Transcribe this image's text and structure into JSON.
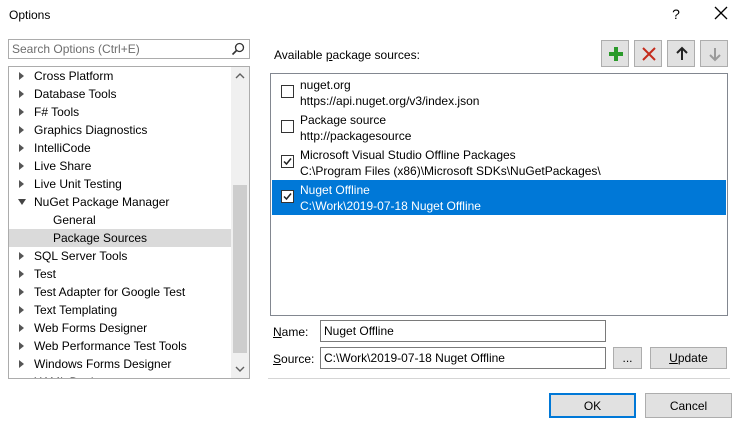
{
  "window": {
    "title": "Options",
    "help_glyph": "?"
  },
  "search": {
    "placeholder": "Search Options (Ctrl+E)"
  },
  "tree": {
    "items": [
      {
        "label": "Cross Platform",
        "level": 0,
        "expanded": false,
        "selected": false
      },
      {
        "label": "Database Tools",
        "level": 0,
        "expanded": false,
        "selected": false
      },
      {
        "label": "F# Tools",
        "level": 0,
        "expanded": false,
        "selected": false
      },
      {
        "label": "Graphics Diagnostics",
        "level": 0,
        "expanded": false,
        "selected": false
      },
      {
        "label": "IntelliCode",
        "level": 0,
        "expanded": false,
        "selected": false
      },
      {
        "label": "Live Share",
        "level": 0,
        "expanded": false,
        "selected": false
      },
      {
        "label": "Live Unit Testing",
        "level": 0,
        "expanded": false,
        "selected": false
      },
      {
        "label": "NuGet Package Manager",
        "level": 0,
        "expanded": true,
        "selected": false
      },
      {
        "label": "General",
        "level": 1,
        "expanded": false,
        "selected": false
      },
      {
        "label": "Package Sources",
        "level": 1,
        "expanded": false,
        "selected": true
      },
      {
        "label": "SQL Server Tools",
        "level": 0,
        "expanded": false,
        "selected": false
      },
      {
        "label": "Test",
        "level": 0,
        "expanded": false,
        "selected": false
      },
      {
        "label": "Test Adapter for Google Test",
        "level": 0,
        "expanded": false,
        "selected": false
      },
      {
        "label": "Text Templating",
        "level": 0,
        "expanded": false,
        "selected": false
      },
      {
        "label": "Web Forms Designer",
        "level": 0,
        "expanded": false,
        "selected": false
      },
      {
        "label": "Web Performance Test Tools",
        "level": 0,
        "expanded": false,
        "selected": false
      },
      {
        "label": "Windows Forms Designer",
        "level": 0,
        "expanded": false,
        "selected": false
      },
      {
        "label": "XAML Designer",
        "level": 0,
        "expanded": false,
        "selected": false
      }
    ]
  },
  "sources_panel": {
    "label_pre": "Available ",
    "label_accel": "p",
    "label_post": "ackage sources:",
    "toolbar": {
      "add_icon": "plus-icon",
      "add_color": "#2a9a2a",
      "remove_icon": "x-icon",
      "remove_color": "#c42b1c",
      "up_icon": "arrow-up-icon",
      "down_icon": "arrow-down-icon"
    },
    "sources": [
      {
        "name": "nuget.org",
        "url": "https://api.nuget.org/v3/index.json",
        "checked": false,
        "selected": false
      },
      {
        "name": "Package source",
        "url": "http://packagesource",
        "checked": false,
        "selected": false
      },
      {
        "name": "Microsoft Visual Studio Offline Packages",
        "url": "C:\\Program Files (x86)\\Microsoft SDKs\\NuGetPackages\\",
        "checked": true,
        "selected": false
      },
      {
        "name": "Nuget Offline",
        "url": "C:\\Work\\2019-07-18 Nuget Offline",
        "checked": true,
        "selected": true
      }
    ]
  },
  "form": {
    "name_label_accel": "N",
    "name_label_rest": "ame:",
    "name_value": "Nuget Offline",
    "source_label_accel": "S",
    "source_label_rest": "ource:",
    "source_value": "C:\\Work\\2019-07-18 Nuget Offline",
    "browse_label": "...",
    "update_label_accel": "U",
    "update_label_rest": "pdate"
  },
  "footer": {
    "ok_label": "OK",
    "cancel_label": "Cancel"
  },
  "colors": {
    "selection": "#0078d7",
    "tree_selection": "#dadada"
  }
}
